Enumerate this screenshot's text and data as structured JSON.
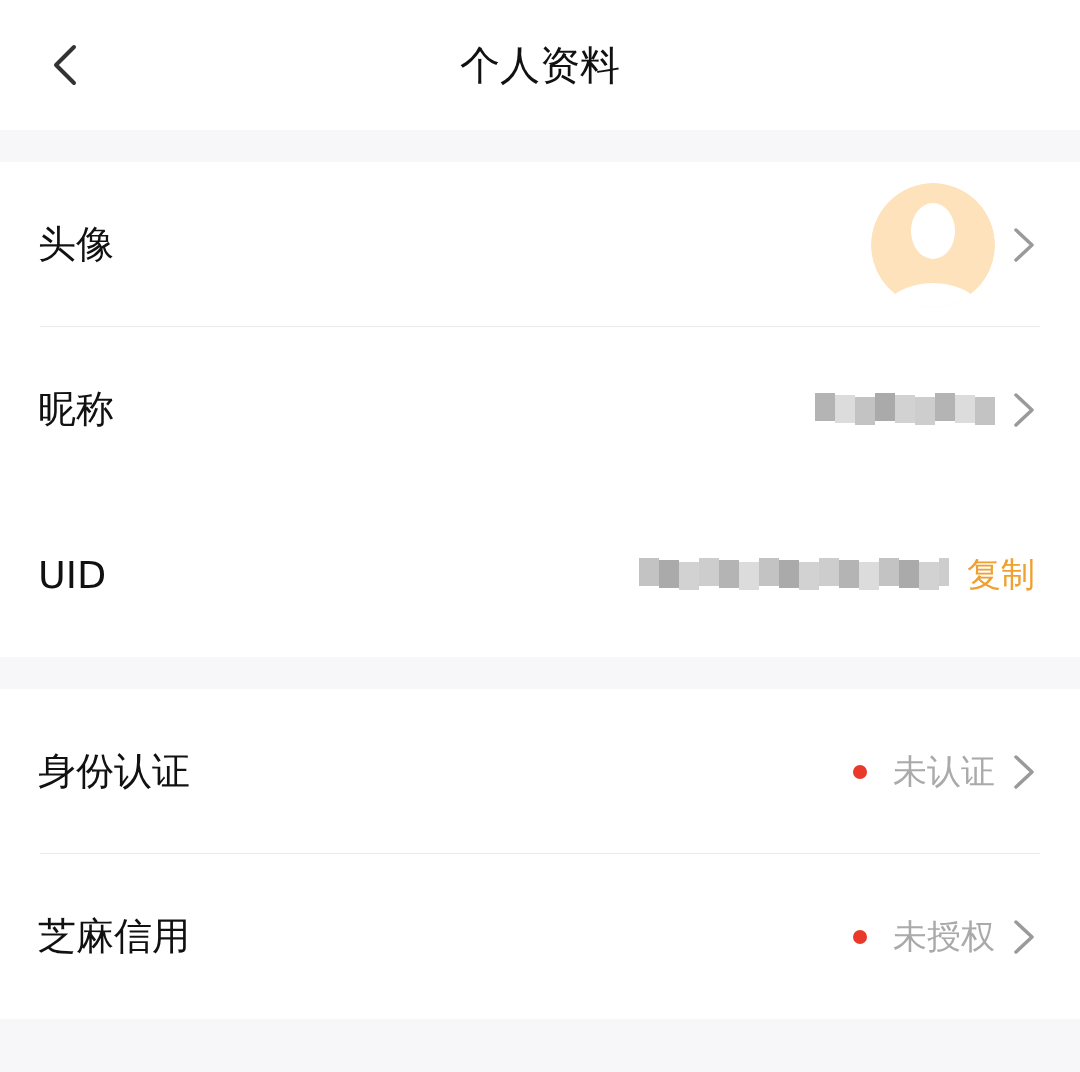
{
  "header": {
    "title": "个人资料"
  },
  "sections": [
    {
      "rows": [
        {
          "kind": "avatar",
          "label": "头像",
          "chevron": true,
          "divider": true
        },
        {
          "kind": "redacted",
          "label": "昵称",
          "chevron": true,
          "divider": false
        },
        {
          "kind": "copy",
          "label": "UID",
          "action": "复制",
          "chevron": false,
          "divider": false
        }
      ]
    },
    {
      "rows": [
        {
          "kind": "status",
          "label": "身份认证",
          "status": "未认证",
          "chevron": true,
          "divider": true
        },
        {
          "kind": "status",
          "label": "芝麻信用",
          "status": "未授权",
          "chevron": true,
          "divider": false
        }
      ]
    }
  ]
}
